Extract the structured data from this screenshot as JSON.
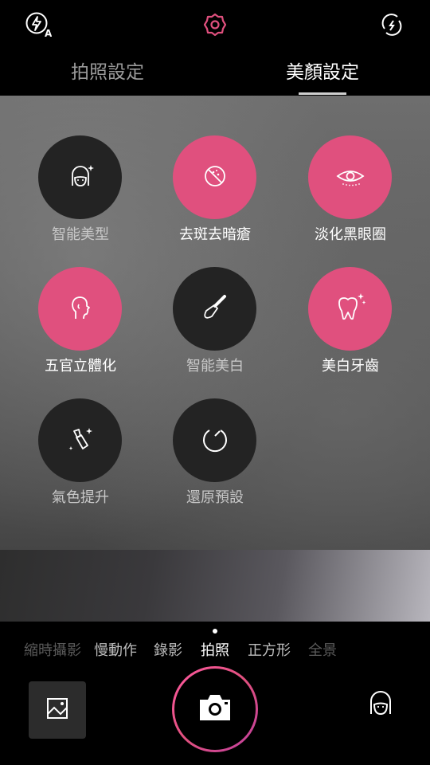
{
  "colors": {
    "accent": "#e0507e",
    "inactive_circle": "#232323"
  },
  "topbar": {
    "icons": [
      "flash-auto-icon",
      "settings-gear-icon",
      "switch-camera-icon"
    ]
  },
  "tabs": {
    "shooting_settings": "拍照設定",
    "beauty_settings": "美顏設定",
    "active": "beauty_settings"
  },
  "beauty_options": [
    {
      "label": "智能美型",
      "icon": "face-sparkle-icon",
      "active": false
    },
    {
      "label": "去斑去暗瘡",
      "icon": "blemish-remove-icon",
      "active": true
    },
    {
      "label": "淡化黑眼圈",
      "icon": "eye-icon",
      "active": true
    },
    {
      "label": "五官立體化",
      "icon": "face-profile-icon",
      "active": true
    },
    {
      "label": "智能美白",
      "icon": "makeup-brush-icon",
      "active": false
    },
    {
      "label": "美白牙齒",
      "icon": "tooth-sparkle-icon",
      "active": true
    },
    {
      "label": "氣色提升",
      "icon": "lipstick-icon",
      "active": false
    },
    {
      "label": "還原預設",
      "icon": "reset-icon",
      "active": false
    }
  ],
  "modes": {
    "items": [
      "縮時攝影",
      "慢動作",
      "錄影",
      "拍照",
      "正方形",
      "全景"
    ],
    "selected": "拍照"
  },
  "bottom": {
    "gallery_icon": "gallery-icon",
    "shutter_icon": "camera-icon",
    "beauty_icon": "face-beauty-icon"
  }
}
